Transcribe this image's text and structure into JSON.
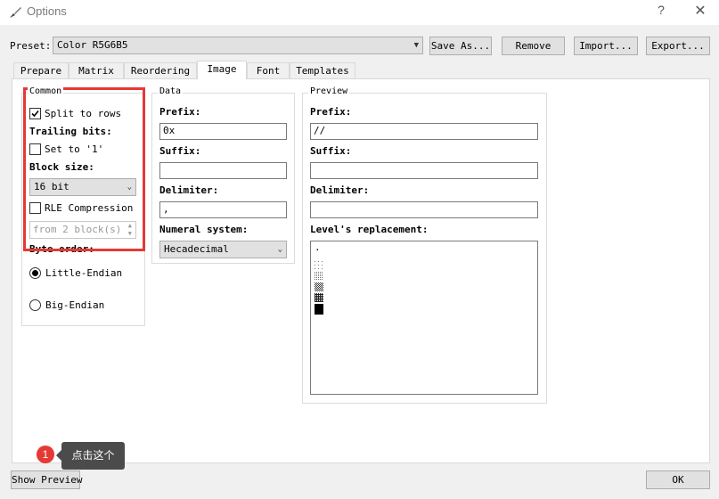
{
  "window": {
    "title": "Options",
    "help": "?",
    "close": "✕"
  },
  "preset": {
    "label": "Preset:",
    "value": "Color R5G6B5",
    "save_as": "Save As...",
    "remove": "Remove",
    "import": "Import...",
    "export": "Export..."
  },
  "tabs": [
    "Prepare",
    "Matrix",
    "Reordering",
    "Image",
    "Font",
    "Templates"
  ],
  "active_tab": "Image",
  "common": {
    "title": "Common",
    "split_to_rows": {
      "label": "Split to rows",
      "checked": true
    },
    "trailing_bits_label": "Trailing bits:",
    "set_to_1": {
      "label": "Set to '1'",
      "checked": false
    },
    "block_size_label": "Block size:",
    "block_size_value": "16 bit",
    "rle": {
      "label": "RLE Compression",
      "checked": false
    },
    "rle_from": "from 2 block(s)",
    "byte_order_label": "Byte order:",
    "little_endian": {
      "label": "Little-Endian",
      "selected": true
    },
    "big_endian": {
      "label": "Big-Endian",
      "selected": false
    }
  },
  "data": {
    "title": "Data",
    "prefix_label": "Prefix:",
    "prefix_value": "0x",
    "suffix_label": "Suffix:",
    "suffix_value": "",
    "delimiter_label": "Delimiter:",
    "delimiter_value": ",",
    "numeral_label": "Numeral system:",
    "numeral_value": "Hecadecimal"
  },
  "preview": {
    "title": "Preview",
    "prefix_label": "Prefix:",
    "prefix_value": "//",
    "suffix_label": "Suffix:",
    "suffix_value": "",
    "delimiter_label": "Delimiter:",
    "delimiter_value": "",
    "levels_label": "Level's replacement:",
    "level_first": "."
  },
  "footer": {
    "show_preview": "Show Preview",
    "ok": "OK"
  },
  "annotation": {
    "step": "1",
    "text": "点击这个",
    "color": "#e53935"
  }
}
